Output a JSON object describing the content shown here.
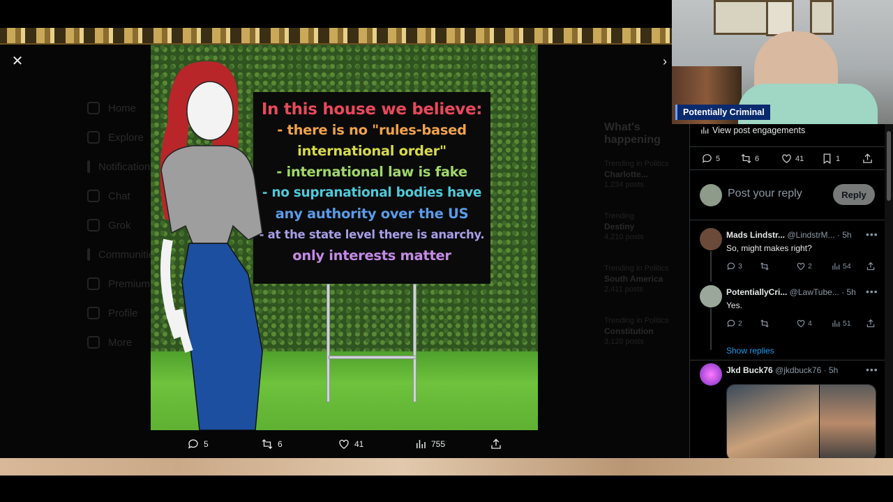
{
  "viewer": {
    "close_icon": "close-icon",
    "close_label": "✕",
    "next_label": "›"
  },
  "background_app": {
    "nav": [
      "Home",
      "Explore",
      "Notifications",
      "Chat",
      "Grok",
      "Communities",
      "Premium",
      "Profile",
      "More"
    ],
    "trends_title": "What's happening",
    "trends": [
      {
        "context": "Trending in Politics",
        "name": "Charlotte...",
        "count": "1,234 posts"
      },
      {
        "context": "Trending",
        "name": "Destiny",
        "count": "4,210 posts"
      },
      {
        "context": "Trending in Politics",
        "name": "South America",
        "count": "2,411 posts"
      },
      {
        "context": "Trending in Politics",
        "name": "Constitution",
        "count": "3,120 posts"
      }
    ]
  },
  "sign": {
    "lines": [
      {
        "text": "In this house we believe:",
        "color": "#e8495a"
      },
      {
        "text": "- there is no \"rules-based",
        "color": "#f0a24a"
      },
      {
        "text": "international order\"",
        "color": "#d7d94a"
      },
      {
        "text": "- international law is fake",
        "color": "#9fd86a"
      },
      {
        "text": "- no supranational bodies have",
        "color": "#4fc9d8"
      },
      {
        "text": "any authority over the US",
        "color": "#5a9ce8"
      },
      {
        "text": "- at the state level there is anarchy.",
        "color": "#a89ee8"
      },
      {
        "text": "only interests matter",
        "color": "#c48ae8"
      }
    ]
  },
  "media_actions": {
    "replies": "5",
    "reposts": "6",
    "likes": "41",
    "views": "755"
  },
  "panel": {
    "engagements_label": "View post engagements",
    "stats": {
      "replies": "5",
      "reposts": "6",
      "likes": "41",
      "bookmarks": "1"
    },
    "reply_placeholder": "Post your reply",
    "reply_button": "Reply",
    "show_replies": "Show replies",
    "tweets": [
      {
        "name": "Mads Lindstr...",
        "handle": "@LindstrM...",
        "time": "· 5h",
        "text": "So, might makes right?",
        "replies": "3",
        "reposts": "",
        "likes": "2",
        "views": "54",
        "avatar_color": "#6b4a3a"
      },
      {
        "name": "PotentiallyCri...",
        "handle": "@LawTube...",
        "time": "· 5h",
        "text": "Yes.",
        "replies": "2",
        "reposts": "",
        "likes": "4",
        "views": "51",
        "avatar_color": "#9aa79a"
      },
      {
        "name": "Jkd Buck76",
        "handle": "@jkdbuck76",
        "time": "· 5h",
        "text": "",
        "avatar_color": "#c04ad8"
      }
    ]
  },
  "webcam": {
    "label": "Potentially Criminal"
  },
  "colors": {
    "accent": "#1d9bf0",
    "muted": "#8b98a5",
    "divider": "#2f3336",
    "cam_label_bg": "#0a2a6e"
  }
}
